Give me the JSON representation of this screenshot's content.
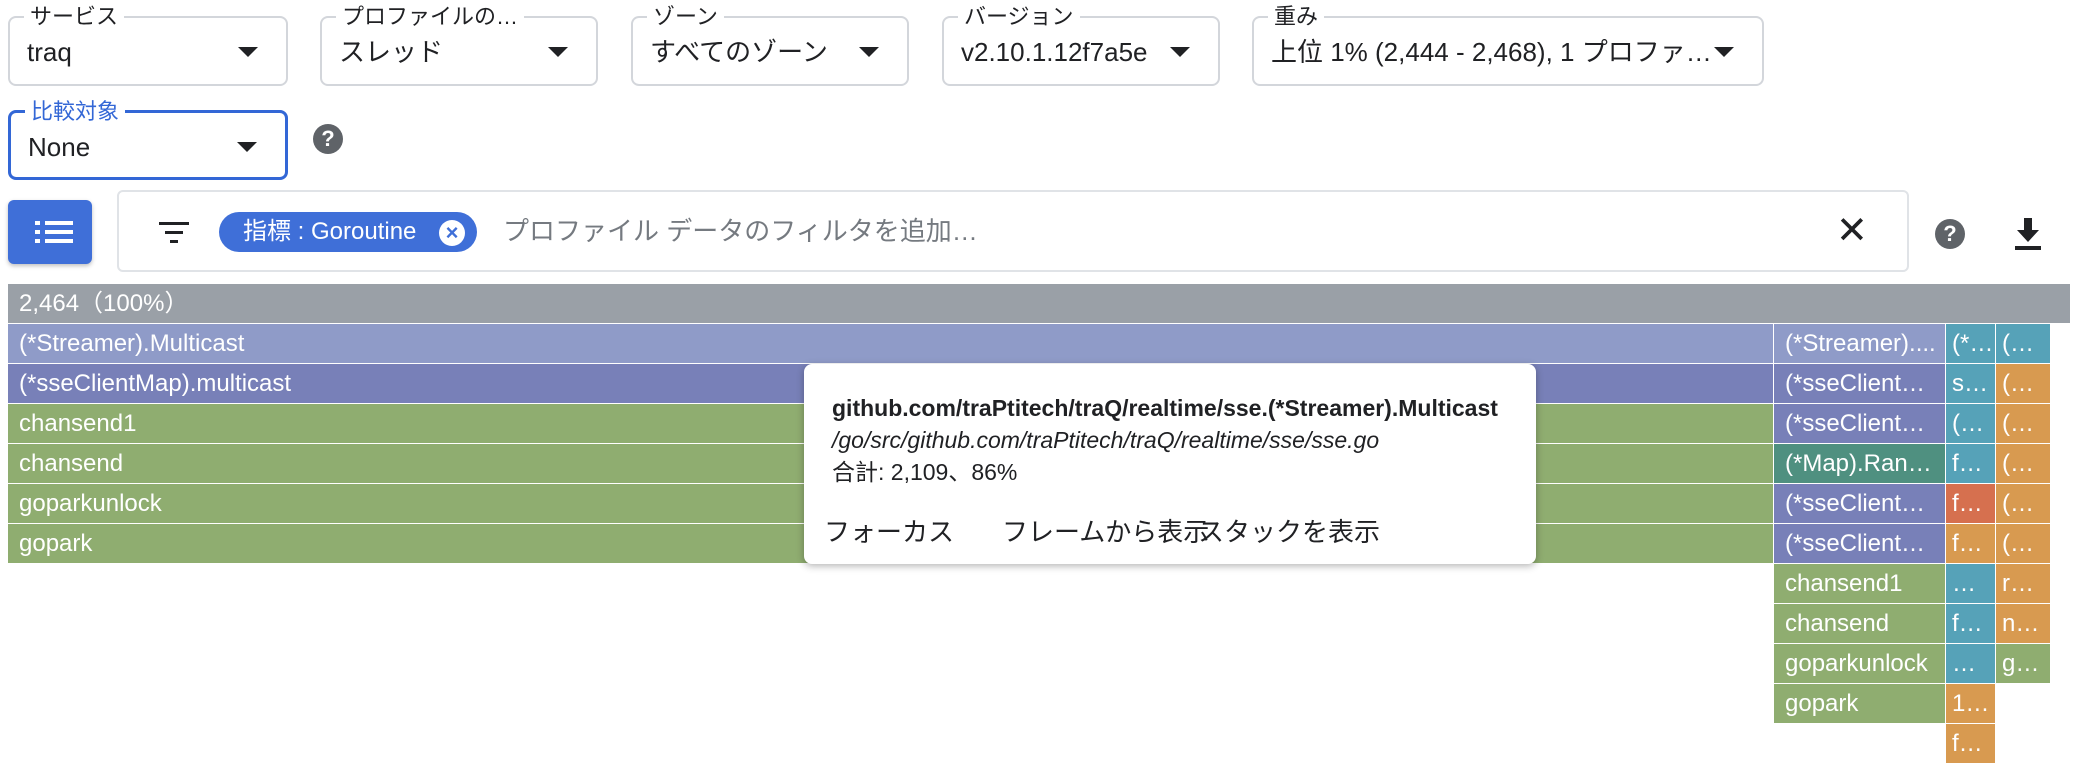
{
  "selectors": [
    {
      "label": "サービス",
      "value": "traq"
    },
    {
      "label": "プロファイルの…",
      "value": "スレッド"
    },
    {
      "label": "ゾーン",
      "value": "すべてのゾーン"
    },
    {
      "label": "バージョン",
      "value": "v2.10.1.12f7a5e"
    },
    {
      "label": "重み",
      "value": "上位 1% (2,444 - 2,468), 1 プロファ…"
    },
    {
      "label": "比較対象",
      "value": "None"
    }
  ],
  "help_glyph": "?",
  "filter": {
    "chip_label": "指標 : Goroutine",
    "chip_remove": "×",
    "placeholder": "プロファイル データのフィルタを追加…",
    "clear": "✕"
  },
  "flame": {
    "root_label": "2,464（100%）",
    "colors": {
      "root": "#9aa0a7",
      "lavender": "#8f9bc8",
      "indigo": "#7880b8",
      "green": "#8fad70",
      "teal": "#56a2b8",
      "orange": "#d89a50",
      "red": "#d6704f",
      "dark_teal": "#4f9080"
    },
    "frames": [
      {
        "depth": 1,
        "label": "(*Streamer).Multicast",
        "color": "lavender"
      },
      {
        "depth": 2,
        "label": "(*sseClientMap).multicast",
        "color": "indigo"
      },
      {
        "depth": 3,
        "label": "chansend1",
        "color": "green"
      },
      {
        "depth": 4,
        "label": "chansend",
        "color": "green"
      },
      {
        "depth": 5,
        "label": "goparkunlock",
        "color": "green"
      },
      {
        "depth": 6,
        "label": "gopark",
        "color": "green"
      },
      {
        "depth": 1,
        "label": "(*Streamer)....",
        "color": "lavender"
      },
      {
        "depth": 2,
        "label": "(*sseClient…",
        "color": "indigo"
      },
      {
        "depth": 3,
        "label": "(*sseClient…",
        "color": "indigo"
      },
      {
        "depth": 4,
        "label": "(*Map).Ran…",
        "color": "dark_teal"
      },
      {
        "depth": 5,
        "label": "(*sseClient…",
        "color": "indigo"
      },
      {
        "depth": 6,
        "label": "(*sseClient…",
        "color": "indigo"
      },
      {
        "depth": 7,
        "label": "chansend1",
        "color": "green"
      },
      {
        "depth": 8,
        "label": "chansend",
        "color": "green"
      },
      {
        "depth": 9,
        "label": "goparkunlock",
        "color": "green"
      },
      {
        "depth": 10,
        "label": "gopark",
        "color": "green"
      },
      {
        "depth": 1,
        "label": "(*…",
        "color": "teal"
      },
      {
        "depth": 2,
        "label": "s…",
        "color": "teal"
      },
      {
        "depth": 3,
        "label": "(…",
        "color": "teal"
      },
      {
        "depth": 4,
        "label": "f…",
        "color": "teal"
      },
      {
        "depth": 5,
        "label": "f…",
        "color": "red"
      },
      {
        "depth": 6,
        "label": "f…",
        "color": "orange"
      },
      {
        "depth": 7,
        "label": "…",
        "color": "teal"
      },
      {
        "depth": 8,
        "label": "f…",
        "color": "teal"
      },
      {
        "depth": 9,
        "label": "…",
        "color": "teal"
      },
      {
        "depth": 10,
        "label": "1…",
        "color": "orange"
      },
      {
        "depth": 11,
        "label": "f…",
        "color": "orange"
      },
      {
        "depth": 1,
        "label": "(…",
        "color": "teal"
      },
      {
        "depth": 2,
        "label": "(…",
        "color": "orange"
      },
      {
        "depth": 3,
        "label": "(…",
        "color": "orange"
      },
      {
        "depth": 4,
        "label": "(…",
        "color": "orange"
      },
      {
        "depth": 5,
        "label": "(…",
        "color": "orange"
      },
      {
        "depth": 6,
        "label": "(…",
        "color": "orange"
      },
      {
        "depth": 7,
        "label": "r…",
        "color": "orange"
      },
      {
        "depth": 8,
        "label": "n…",
        "color": "orange"
      },
      {
        "depth": 9,
        "label": "g…",
        "color": "green"
      }
    ]
  },
  "tooltip": {
    "function": "github.com/traPtitech/traQ/realtime/sse.(*Streamer).Multicast",
    "file": "/go/src/github.com/traPtitech/traQ/realtime/sse/sse.go",
    "total": "合計: 2,109、86%",
    "actions": [
      "フォーカス",
      "フレームから表示",
      "スタックを表示"
    ]
  }
}
